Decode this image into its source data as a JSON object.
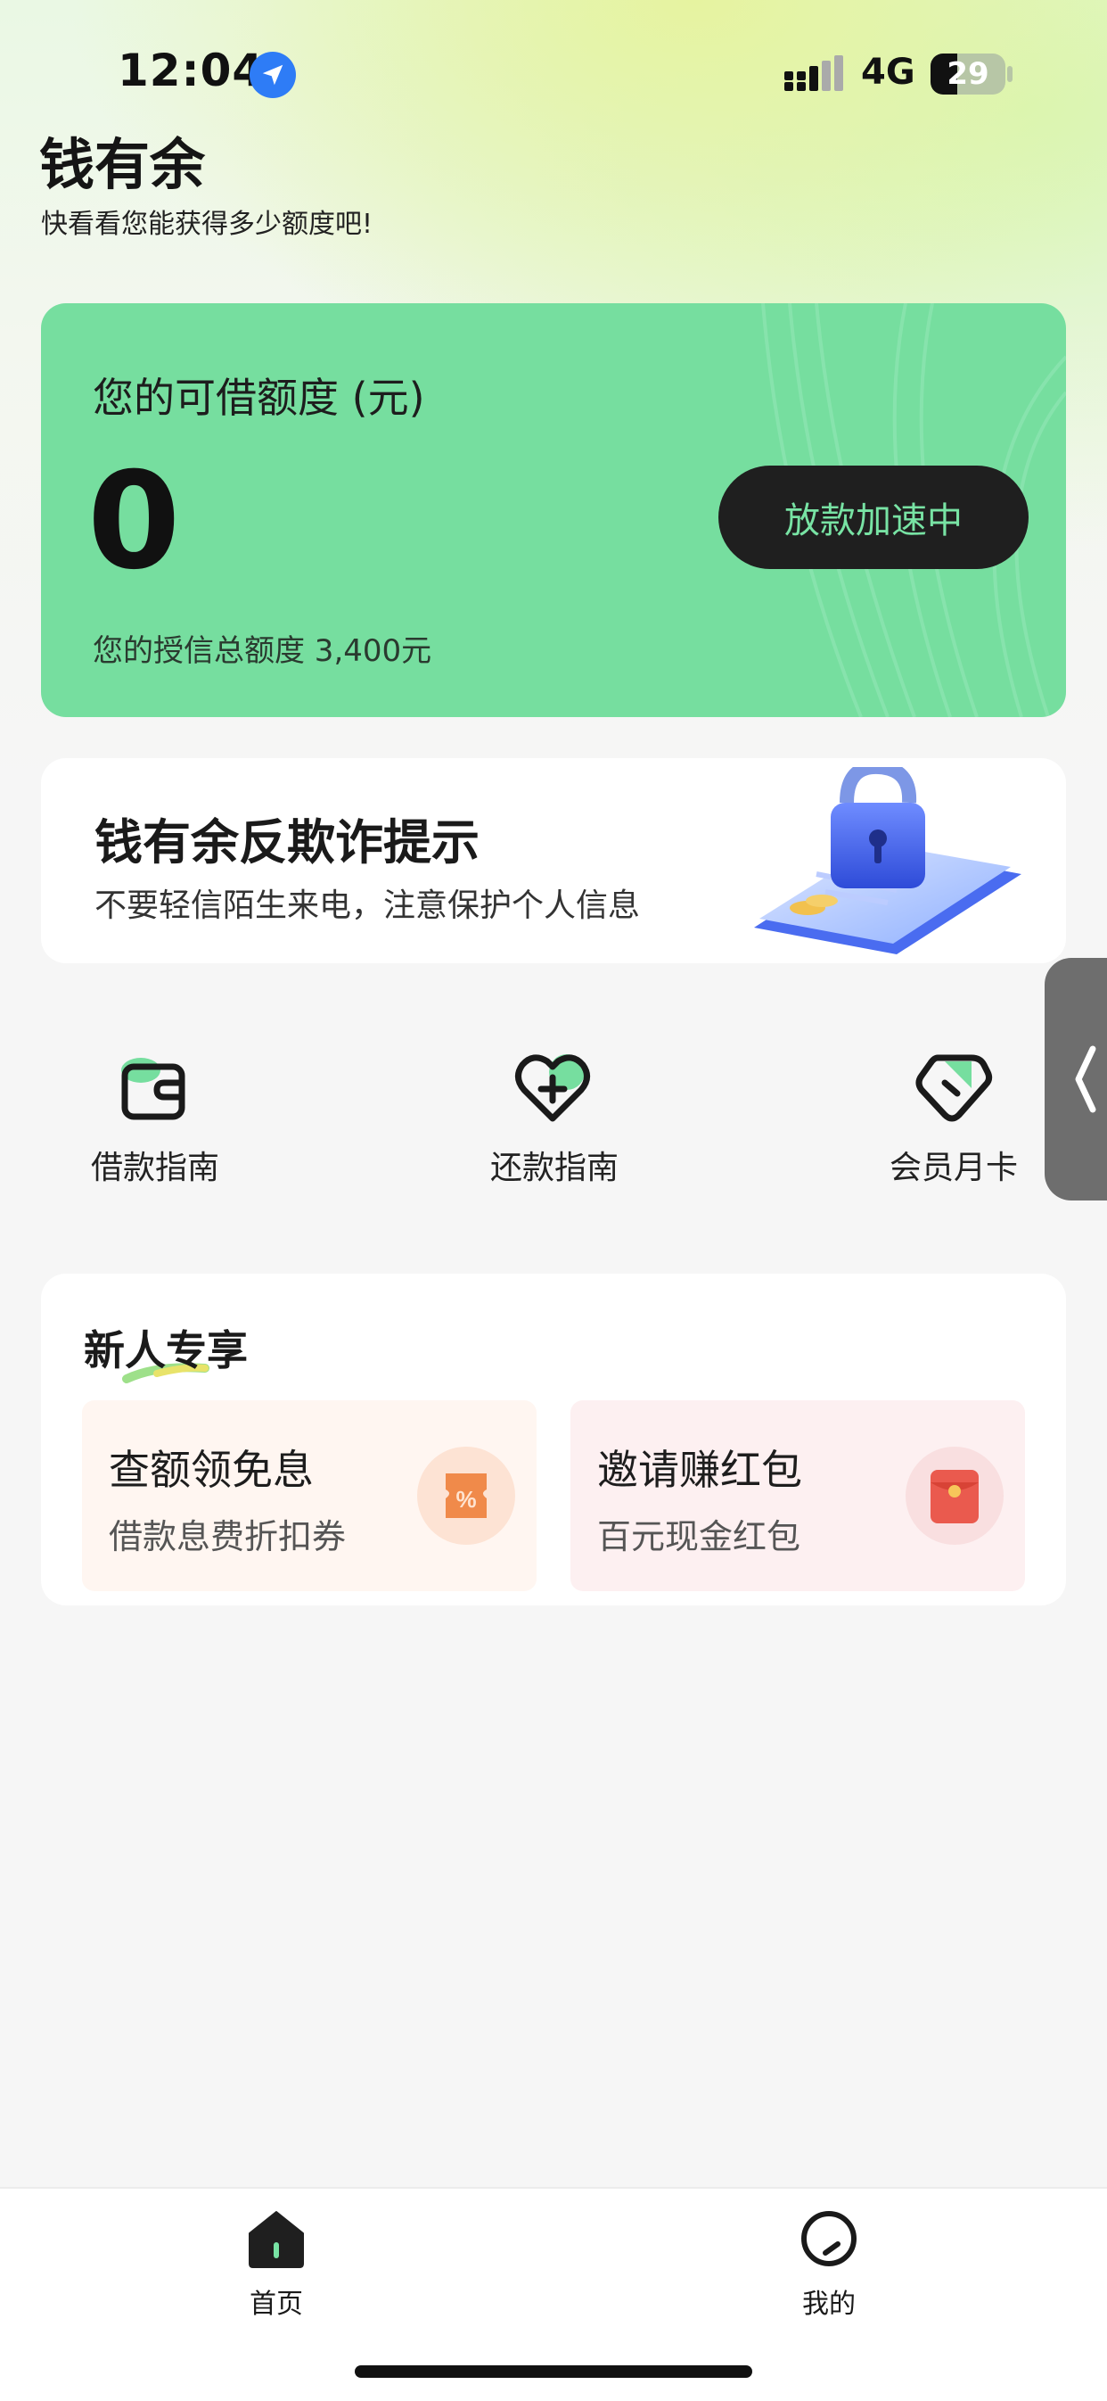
{
  "status_bar": {
    "time": "12:04",
    "network": "4G",
    "battery": "29"
  },
  "header": {
    "title": "钱有余",
    "subtitle": "快看看您能获得多少额度吧!"
  },
  "credit": {
    "label": "您的可借额度 (元)",
    "amount": "0",
    "total_text": "您的授信总额度 3,400元",
    "button_label": "放款加速中"
  },
  "fraud_banner": {
    "title": "钱有余反欺诈提示",
    "subtitle": "不要轻信陌生来电，注意保护个人信息"
  },
  "quick_menu": [
    {
      "label": "借款指南",
      "icon": "wallet-icon"
    },
    {
      "label": "还款指南",
      "icon": "heart-plus-icon"
    },
    {
      "label": "会员月卡",
      "icon": "tag-icon"
    }
  ],
  "newbie": {
    "title": "新人专享",
    "cards": [
      {
        "title": "查额领免息",
        "subtitle": "借款息费折扣券",
        "icon": "discount-coupon-icon"
      },
      {
        "title": "邀请赚红包",
        "subtitle": "百元现金红包",
        "icon": "red-envelope-icon"
      }
    ]
  },
  "bottom_nav": [
    {
      "label": "首页",
      "icon": "home-icon",
      "active": true
    },
    {
      "label": "我的",
      "icon": "profile-icon",
      "active": false
    }
  ],
  "colors": {
    "brand_green": "#76de9f",
    "button_dark": "#1f1f1f",
    "button_text": "#78e3a4"
  }
}
